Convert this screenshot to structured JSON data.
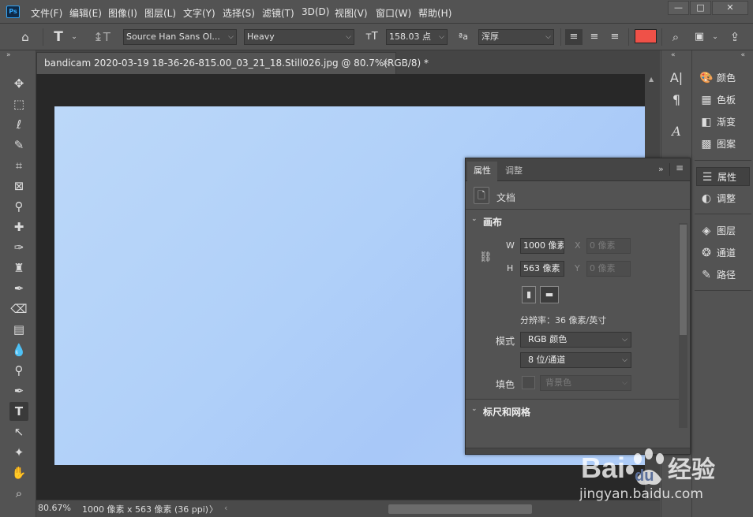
{
  "app": {
    "logo": "Ps"
  },
  "menu": [
    "文件(F)",
    "编辑(E)",
    "图像(I)",
    "图层(L)",
    "文字(Y)",
    "选择(S)",
    "滤镜(T)",
    "3D(D)",
    "视图(V)",
    "窗口(W)",
    "帮助(H)"
  ],
  "window_controls": {
    "minimize": "—",
    "restore": "□",
    "close": "✕"
  },
  "options": {
    "font_family": "Source Han Sans Ol...",
    "font_style": "Heavy",
    "font_size": "158.03 点",
    "aa_label": "ªa",
    "antialias": "浑厚",
    "text_color": "#ef5148"
  },
  "document": {
    "tab_title": "bandicam 2020-03-19 18-36-26-815.00_03_21_18.Still026.jpg @ 80.7%(RGB/8) *",
    "close": "×"
  },
  "status": {
    "zoom": "80.67%",
    "info": "1000 像素 x 563 像素 (36 ppi)",
    "arrow": "〉"
  },
  "right_panel": {
    "group1": [
      {
        "icon": "palette-icon",
        "glyph": "🎨",
        "label": "颜色"
      },
      {
        "icon": "grid-icon",
        "glyph": "▦",
        "label": "色板"
      },
      {
        "icon": "gradient-icon",
        "glyph": "◧",
        "label": "渐变"
      },
      {
        "icon": "pattern-icon",
        "glyph": "▩",
        "label": "图案"
      }
    ],
    "group2": [
      {
        "icon": "properties-icon",
        "glyph": "☰",
        "label": "属性"
      },
      {
        "icon": "adjustments-icon",
        "glyph": "◐",
        "label": "调整"
      }
    ],
    "group3": [
      {
        "icon": "layers-icon",
        "glyph": "◈",
        "label": "图层"
      },
      {
        "icon": "channels-icon",
        "glyph": "❂",
        "label": "通道"
      },
      {
        "icon": "paths-icon",
        "glyph": "✎",
        "label": "路径"
      }
    ]
  },
  "properties": {
    "tabs": [
      "属性",
      "调整"
    ],
    "doc_label": "文档",
    "canvas_header": "画布",
    "w_label": "W",
    "w_value": "1000 像素",
    "x_label": "X",
    "x_value": "0 像素",
    "h_label": "H",
    "h_value": "563 像素",
    "y_label": "Y",
    "y_value": "0 像素",
    "resolution": "分辨率：36 像素/英寸",
    "mode_label": "模式",
    "mode_value": "RGB 颜色",
    "depth_value": "8 位/通道",
    "fill_label": "填色",
    "fill_value": "背景色",
    "rulers_header": "标尺和网格"
  },
  "watermark": {
    "brand": "Bai",
    "brand2": "du",
    "cn": "经验",
    "url": "jingyan.baidu.com"
  }
}
